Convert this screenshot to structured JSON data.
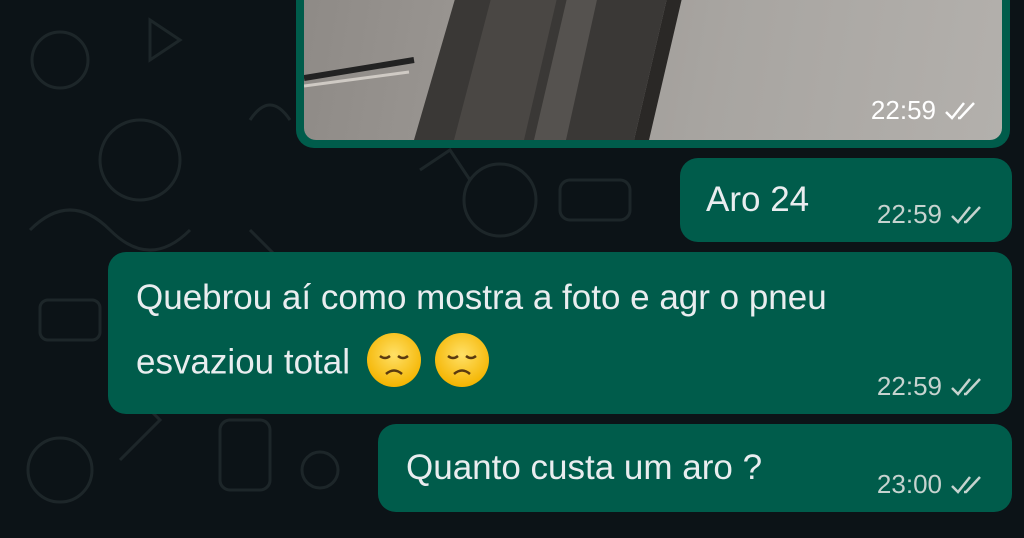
{
  "messages": [
    {
      "type": "image",
      "time": "22:59",
      "status_icon": "double-check-icon"
    },
    {
      "type": "text",
      "text": "Aro 24",
      "time": "22:59",
      "status_icon": "double-check-icon"
    },
    {
      "type": "text",
      "line1": "Quebrou aí como mostra a foto e agr o pneu",
      "line2": "esvaziou total",
      "emojis": [
        "disappointed-face-emoji",
        "disappointed-face-emoji"
      ],
      "time": "22:59",
      "status_icon": "double-check-icon"
    },
    {
      "type": "text",
      "text": "Quanto custa um aro ?",
      "time": "23:00",
      "status_icon": "double-check-icon"
    }
  ],
  "colors": {
    "background": "#0c1317",
    "outgoing_bubble": "#005c4b",
    "text": "#e9edef",
    "meta_text": "#c6d3cf"
  }
}
